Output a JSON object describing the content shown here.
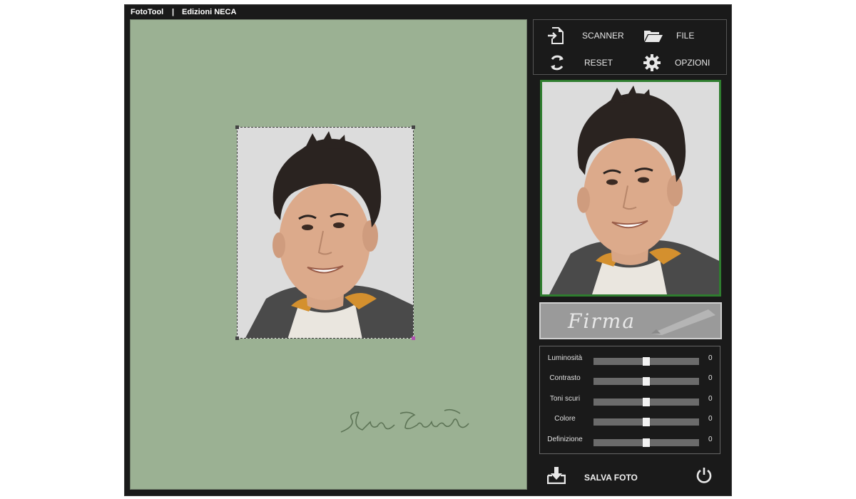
{
  "window": {
    "app_name": "FotoTool",
    "separator": "|",
    "publisher": "Edizioni NECA"
  },
  "toolbar": {
    "scanner_label": "SCANNER",
    "file_label": "FILE",
    "reset_label": "RESET",
    "opzioni_label": "OPZIONI"
  },
  "firma": {
    "label": "Firma"
  },
  "adjustments": [
    {
      "label": "Luminosità",
      "value": "0",
      "level": 0.5
    },
    {
      "label": "Contrasto",
      "value": "0",
      "level": 0.5
    },
    {
      "label": "Toni scuri",
      "value": "0",
      "level": 0.5
    },
    {
      "label": "Colore",
      "value": "0",
      "level": 0.5
    },
    {
      "label": "Definizione",
      "value": "0",
      "level": 0.5
    }
  ],
  "footer": {
    "save_label": "SALVA FOTO"
  },
  "colors": {
    "canvas_bg": "#9bb193",
    "preview_border": "#2f7d2f",
    "panel_bg": "#1a1a1a"
  }
}
